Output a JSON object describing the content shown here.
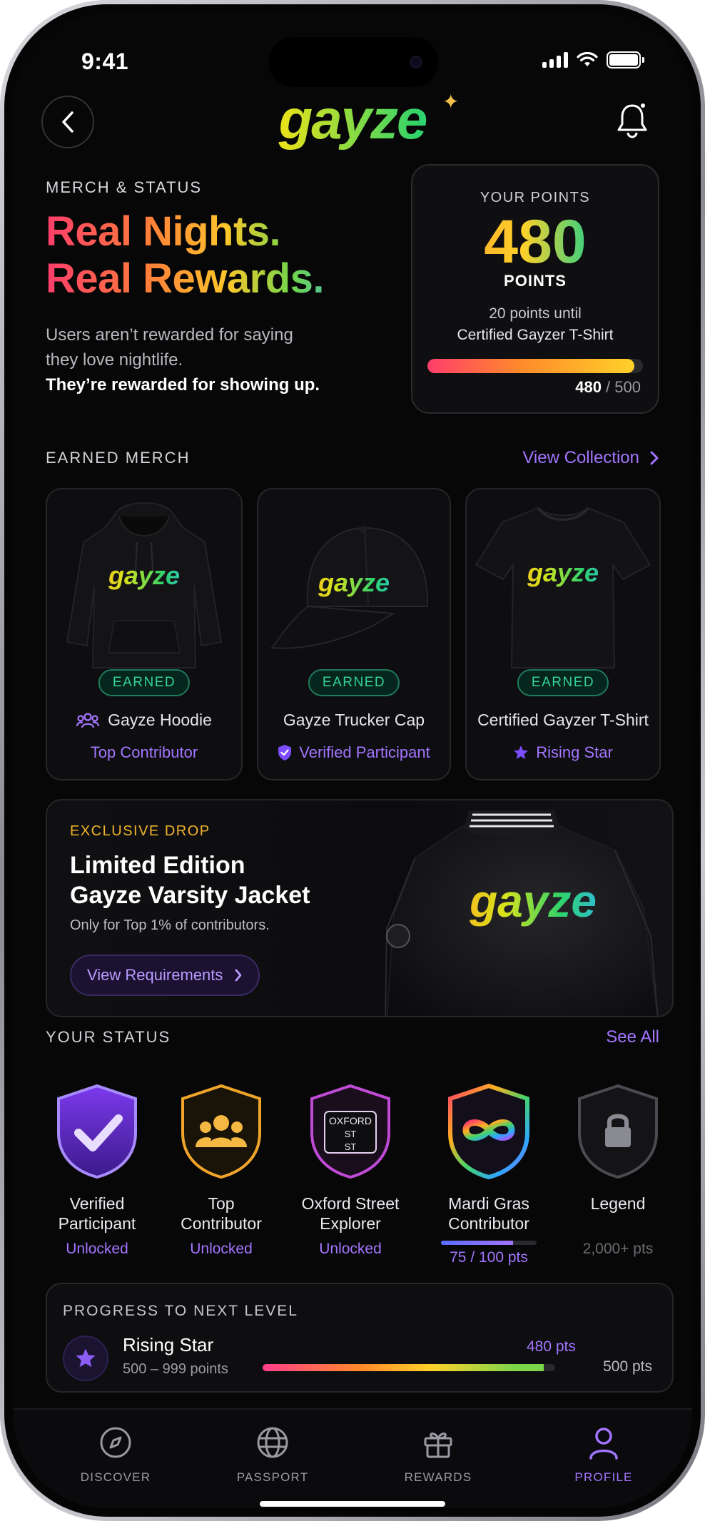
{
  "status_bar": {
    "time": "9:41"
  },
  "header": {
    "logo": "gayze"
  },
  "hero": {
    "eyebrow": "MERCH & STATUS",
    "headline_line1": "Real Nights.",
    "headline_line2": "Real Rewards.",
    "copy_line1": "Users aren’t rewarded for saying",
    "copy_line2": "they love nightlife.",
    "copy_emphasis": "They’re rewarded for showing up."
  },
  "points": {
    "label": "YOUR POINTS",
    "value": "480",
    "unit": "POINTS",
    "until_line1": "20 points until",
    "until_line2": "Certified Gayzer T-Shirt",
    "current": "480",
    "separator": " / ",
    "goal": "500",
    "progress_fraction": 0.96
  },
  "earned_merch": {
    "title": "EARNED MERCH",
    "link": "View Collection",
    "items": [
      {
        "logo": "gayze",
        "badge": "EARNED",
        "name": "Gayze Hoodie",
        "tag": "Top Contributor",
        "icon": "group-icon"
      },
      {
        "logo": "gayze",
        "badge": "EARNED",
        "name": "Gayze Trucker Cap",
        "tag": "Verified Participant",
        "icon": "shield-check-icon"
      },
      {
        "logo": "gayze",
        "badge": "EARNED",
        "name": "Certified Gayzer T-Shirt",
        "tag": "Rising Star",
        "icon": "star-icon"
      }
    ]
  },
  "drop": {
    "eyebrow": "EXCLUSIVE DROP",
    "title_line1": "Limited Edition",
    "title_line2": "Gayze Varsity Jacket",
    "subtitle": "Only for Top 1% of contributors.",
    "button": "View Requirements",
    "jacket_logo": "gayze"
  },
  "status": {
    "title": "YOUR STATUS",
    "link": "See All",
    "badges": [
      {
        "name_line1": "Verified",
        "name_line2": "Participant",
        "state": "Unlocked",
        "icon": "check-shield-icon"
      },
      {
        "name_line1": "Top",
        "name_line2": "Contributor",
        "state": "Unlocked",
        "icon": "group-shield-icon"
      },
      {
        "name_line1": "Oxford Street",
        "name_line2": "Explorer",
        "state": "Unlocked",
        "icon": "street-sign-shield-icon",
        "sign_line1": "OXFORD",
        "sign_line2": "ST",
        "sign_line3": "ST"
      },
      {
        "name_line1": "Mardi Gras",
        "name_line2": "Contributor",
        "progress": "75 / 100 pts",
        "progress_fraction": 0.75,
        "icon": "infinity-shield-icon"
      },
      {
        "name_line1": "Legend",
        "name_line2": "",
        "state": "2,000+ pts",
        "icon": "lock-shield-icon"
      }
    ]
  },
  "next_level": {
    "title": "PROGRESS TO NEXT LEVEL",
    "name": "Rising Star",
    "range": "500 – 999 points",
    "current": "480 pts",
    "target": "500 pts",
    "progress_fraction": 0.96
  },
  "tabs": [
    {
      "label": "DISCOVER",
      "icon": "compass-icon"
    },
    {
      "label": "PASSPORT",
      "icon": "globe-icon"
    },
    {
      "label": "REWARDS",
      "icon": "gift-icon"
    },
    {
      "label": "PROFILE",
      "icon": "person-icon",
      "active": true
    }
  ],
  "colors": {
    "accent": "#a375ff",
    "earned": "#34d399",
    "drop_eyebrow": "#f0b429",
    "background": "#070707"
  }
}
